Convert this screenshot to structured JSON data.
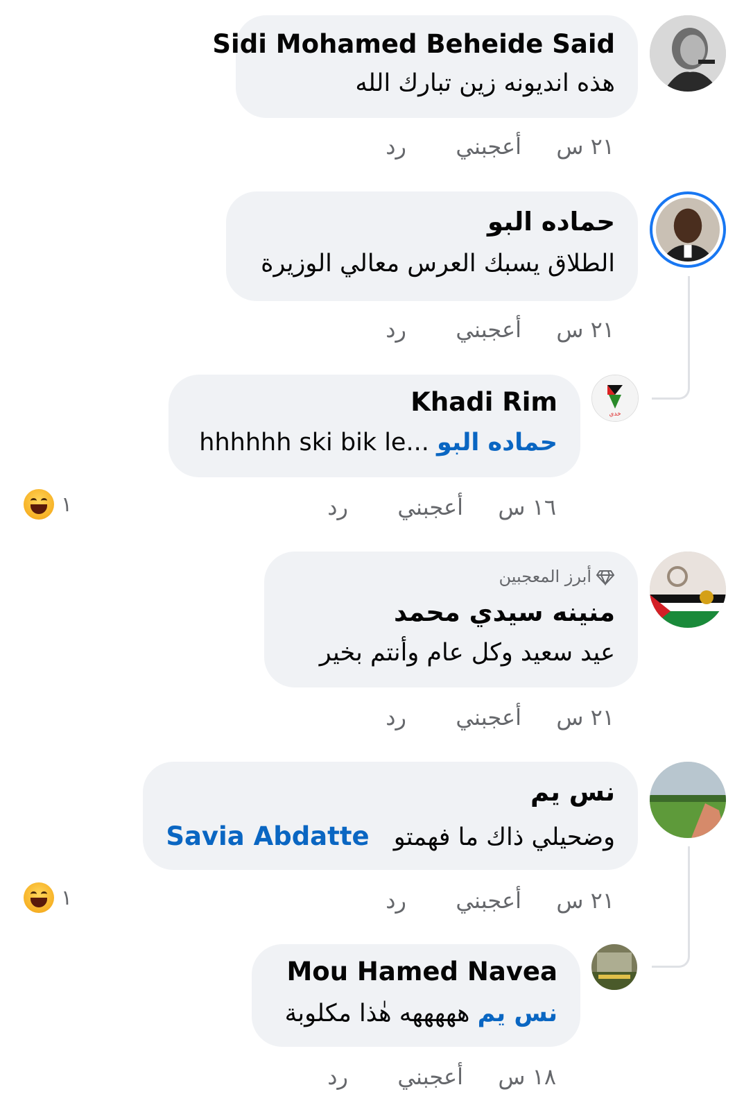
{
  "comments": [
    {
      "name": "Sidi Mohamed Beheide Said",
      "text": "هذه انديونه زين تبارك الله",
      "time": "٢١ س",
      "like": "أعجبني",
      "reply": "رد"
    },
    {
      "name": "حماده البو",
      "text": "الطلاق يسبك العرس معالي الوزيرة",
      "time": "٢١ س",
      "like": "أعجبني",
      "reply": "رد"
    },
    {
      "name": "Khadi Rim",
      "mention": "حماده البو",
      "text": "hhhhhh ski bik le...",
      "time": "١٦ س",
      "like": "أعجبني",
      "reply": "رد",
      "reaction_count": "١"
    },
    {
      "badge": "أبرز المعجبين",
      "name": "منينه سيدي محمد",
      "text": "عيد سعيد وكل عام وأنتم بخير",
      "time": "٢١ س",
      "like": "أعجبني",
      "reply": "رد"
    },
    {
      "name": "نس يم",
      "text": "وضحيلي ذاك ما فهمتو",
      "mention": "Savia Abdatte",
      "time": "٢١ س",
      "like": "أعجبني",
      "reply": "رد",
      "reaction_count": "١"
    },
    {
      "name": "Mou Hamed Navea",
      "mention": "نس يم",
      "text": "هههههه هٰذا مكلوبة",
      "time": "١٨ س",
      "like": "أعجبني",
      "reply": "رد"
    }
  ],
  "colors": {
    "bubble": "#f0f2f5",
    "mention": "#0a66c2",
    "meta": "#65676b",
    "ring": "#1877f2"
  },
  "icons": {
    "top_fan": "diamond-icon",
    "reaction": "haha-emoji-icon"
  }
}
